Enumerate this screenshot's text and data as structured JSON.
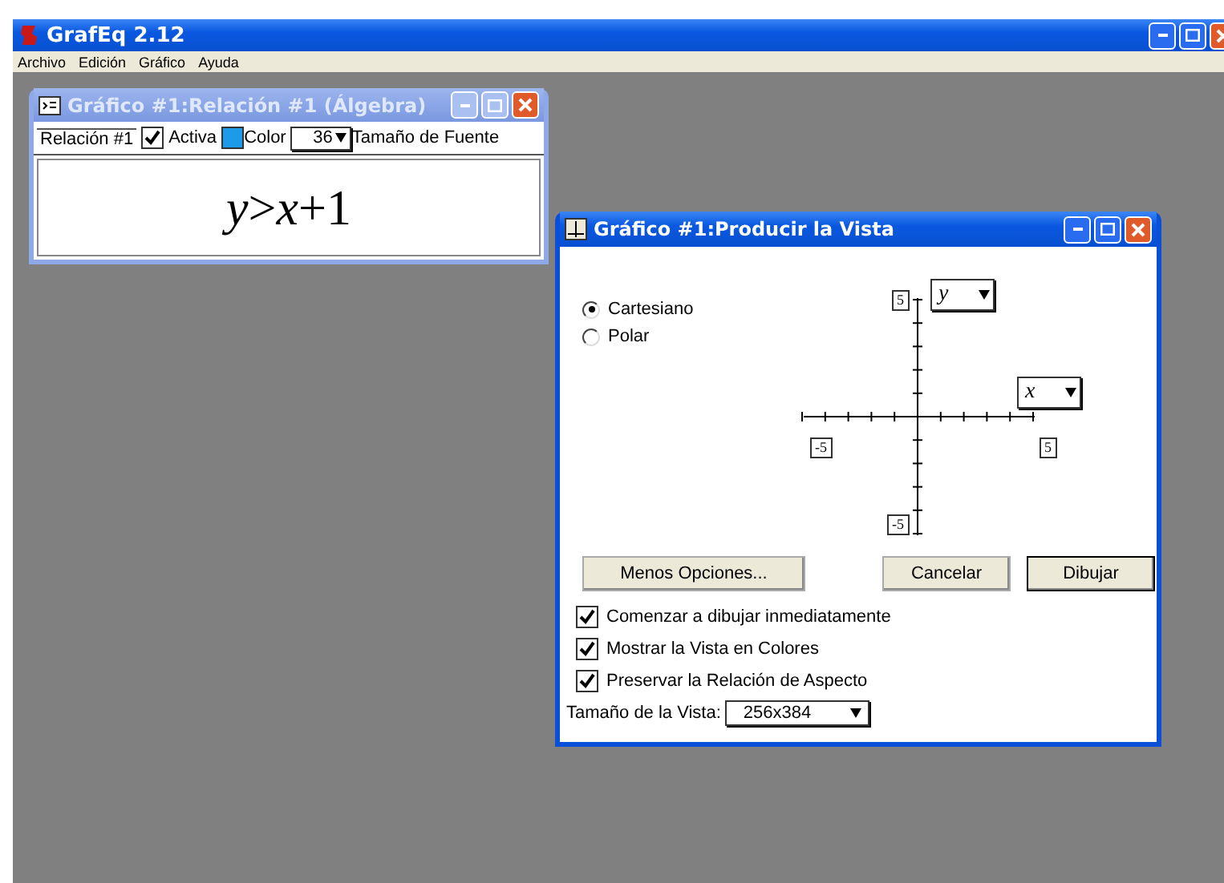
{
  "window": {
    "title": "GrafEq 2.12"
  },
  "menu": [
    "Archivo",
    "Edición",
    "Gráfico",
    "Ayuda"
  ],
  "relation_window": {
    "title": "Gráfico #1:Relación #1 (Álgebra)",
    "tab": "Relación #1",
    "active": {
      "label": "Activa",
      "checked": true
    },
    "color": {
      "label": "Color",
      "color": "#1e9be8"
    },
    "font_size": {
      "value": "36",
      "label": "Tamaño de Fuente"
    },
    "expression": "*y*>*x*+1"
  },
  "view_dialog": {
    "title": "Gráfico #1:Producir la Vista",
    "coordinates": [
      {
        "label": "Cartesiano",
        "selected": true
      },
      {
        "label": "Polar",
        "selected": false
      }
    ],
    "y_axis": {
      "variable": "y",
      "max": "5",
      "min": "-5"
    },
    "x_axis": {
      "variable": "x",
      "min": "-5",
      "max": "5"
    },
    "buttons": [
      "Menos Opciones...",
      "Cancelar",
      "Dibujar"
    ],
    "options": [
      {
        "label": "Comenzar a dibujar inmediatamente",
        "checked": true
      },
      {
        "label": "Mostrar la Vista en Colores",
        "checked": true
      },
      {
        "label": "Preservar la Relación de Aspecto",
        "checked": true
      }
    ],
    "view_size": {
      "label": "Tamaño de la Vista:",
      "value": "256x384"
    }
  }
}
